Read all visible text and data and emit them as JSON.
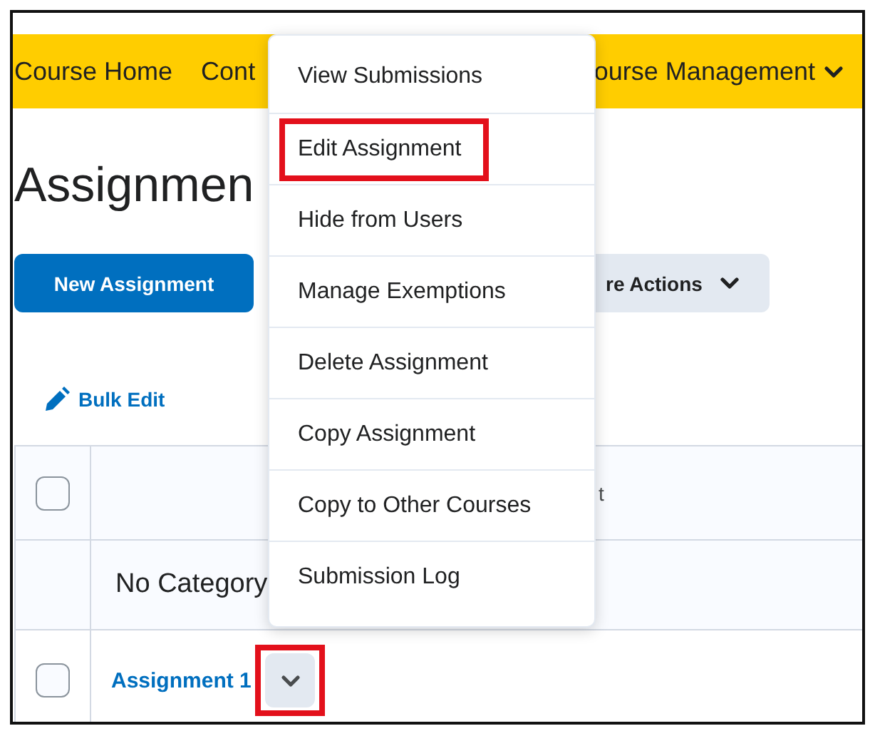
{
  "nav": {
    "items": [
      {
        "label": "Course Home",
        "dropdown": false
      },
      {
        "label": "Cont",
        "dropdown": false
      },
      {
        "label": "ourse Management",
        "dropdown": true
      }
    ]
  },
  "page_title": "Assignmen",
  "buttons": [
    {
      "label": "New Assignment",
      "kind": "primary"
    },
    {
      "label": "re Actions",
      "kind": "dropdown"
    }
  ],
  "bulk_edit": "Bulk Edit",
  "table": {
    "header": {
      "checked": false,
      "column_2": "t"
    },
    "rows": [
      {
        "kind": "category",
        "label": "No Category"
      },
      {
        "kind": "item",
        "label": "Assignment 1",
        "checked": false,
        "highlighted": true
      }
    ]
  },
  "context_menu": {
    "items": [
      {
        "label": "View Submissions",
        "highlighted": false
      },
      {
        "label": "Edit Assignment",
        "highlighted": true
      },
      {
        "label": "Hide from Users",
        "highlighted": false
      },
      {
        "label": "Manage Exemptions",
        "highlighted": false
      },
      {
        "label": "Delete Assignment",
        "highlighted": false
      },
      {
        "label": "Copy Assignment",
        "highlighted": false
      },
      {
        "label": "Copy to Other Courses",
        "highlighted": false
      },
      {
        "label": "Submission Log",
        "highlighted": false
      }
    ]
  }
}
